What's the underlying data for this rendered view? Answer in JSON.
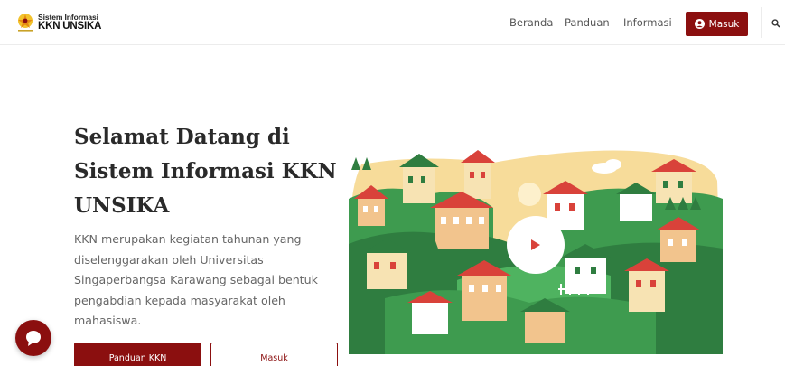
{
  "header": {
    "logo": {
      "line1": "Sistem Informasi",
      "line2": "KKN UNSIKA"
    },
    "nav": [
      {
        "label": "Beranda"
      },
      {
        "label": "Panduan"
      },
      {
        "label": "Informasi"
      }
    ],
    "login_button": {
      "label": "Masuk",
      "icon": "user-circle-icon"
    },
    "search_icon": "search-icon"
  },
  "hero": {
    "title": "Selamat Datang di Sistem Informasi KKN UNSIKA",
    "description": "KKN merupakan kegiatan tahunan yang diselenggarakan oleh Universitas Singaperbangsa Karawang sebagai bentuk pengabdian kepada masyarakat oleh mahasiswa.",
    "buttons": {
      "primary": "Panduan KKN",
      "secondary": "Masuk"
    },
    "illustration_icon": "village-illustration",
    "video_icon": "play-icon"
  },
  "chat": {
    "icon": "chat-icon"
  },
  "colors": {
    "brand": "#8b0f0f",
    "text_heading": "#2a2a2a",
    "text_body": "#666666",
    "illustration_green": "#3e9b4f",
    "illustration_red": "#d9423a",
    "illustration_cream": "#f7dc9a"
  }
}
